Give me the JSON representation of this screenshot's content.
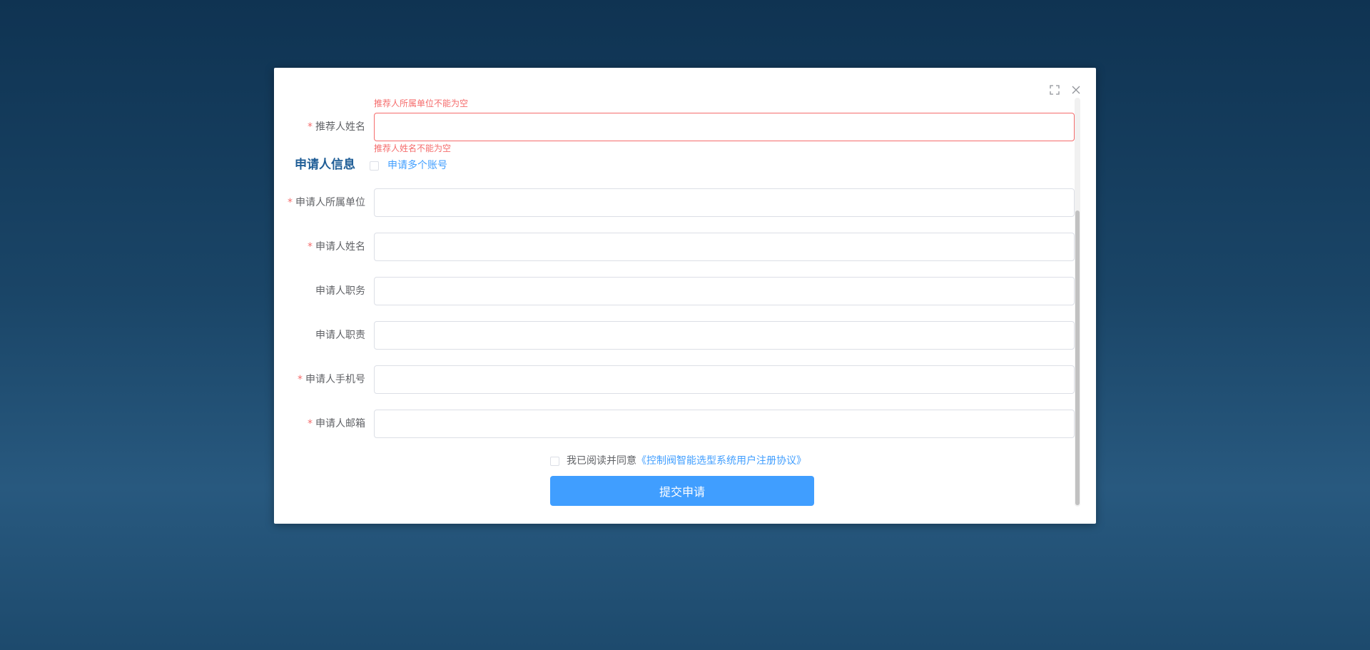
{
  "dialog": {
    "fullscreen_icon": "fullscreen-icon",
    "close_icon": "close-icon"
  },
  "form": {
    "recommender_unit_error": "推荐人所属单位不能为空",
    "recommender_name": {
      "label": "推荐人姓名",
      "required_mark": "*",
      "value": "",
      "error": "推荐人姓名不能为空"
    },
    "applicant_section": {
      "title": "申请人信息",
      "multi_account_label": "申请多个账号"
    },
    "fields": [
      {
        "label": "申请人所属单位",
        "required": true,
        "required_mark": "*",
        "value": ""
      },
      {
        "label": "申请人姓名",
        "required": true,
        "required_mark": "*",
        "value": ""
      },
      {
        "label": "申请人职务",
        "required": false,
        "required_mark": "",
        "value": ""
      },
      {
        "label": "申请人职责",
        "required": false,
        "required_mark": "",
        "value": ""
      },
      {
        "label": "申请人手机号",
        "required": true,
        "required_mark": "*",
        "value": ""
      },
      {
        "label": "申请人邮箱",
        "required": true,
        "required_mark": "*",
        "value": ""
      }
    ],
    "agreement": {
      "prefix": "我已阅读并同意",
      "link": "《控制阀智能选型系统用户注册协议》"
    },
    "submit_label": "提交申请"
  },
  "colors": {
    "accent": "#409eff",
    "error": "#f56c6c",
    "section_title": "#1f5d96"
  }
}
